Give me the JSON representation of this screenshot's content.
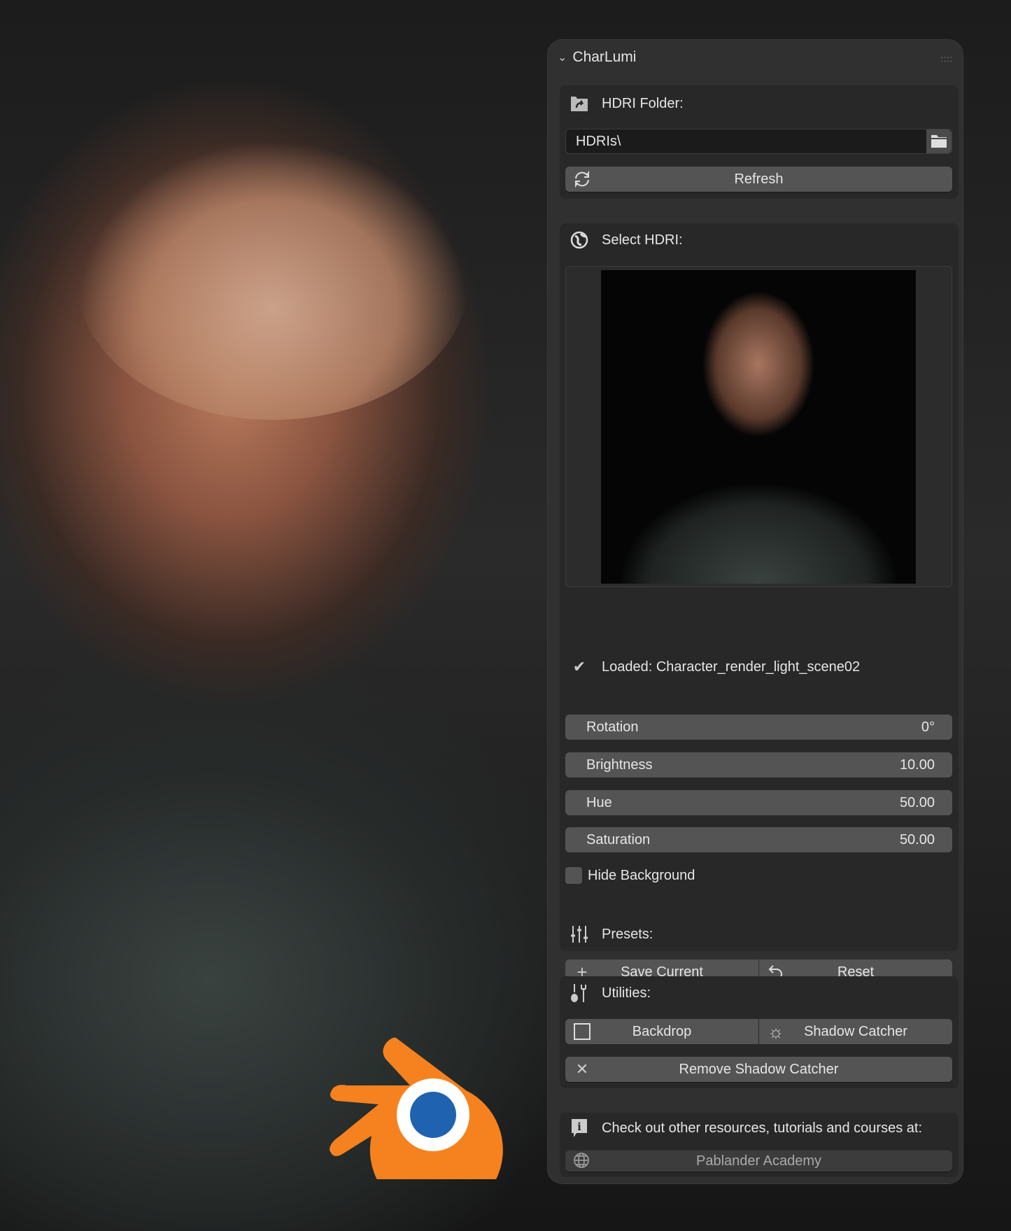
{
  "panel": {
    "title": "CharLumi"
  },
  "hdri_folder": {
    "label": "HDRI Folder:",
    "path": "HDRIs\\",
    "refresh": "Refresh"
  },
  "select_hdri": {
    "label": "Select HDRI:",
    "loaded": "Loaded: Character_render_light_scene02"
  },
  "sliders": [
    {
      "label": "Rotation",
      "value": "0°"
    },
    {
      "label": "Brightness",
      "value": "10.00"
    },
    {
      "label": "Hue",
      "value": "50.00"
    },
    {
      "label": "Saturation",
      "value": "50.00"
    }
  ],
  "hide_background": {
    "label": "Hide Background",
    "checked": false
  },
  "presets": {
    "label": "Presets:",
    "save": "Save Current",
    "reset": "Reset"
  },
  "utilities": {
    "label": "Utilities:",
    "backdrop": "Backdrop",
    "shadow_catcher": "Shadow Catcher",
    "remove_shadow_catcher": "Remove Shadow Catcher"
  },
  "info": {
    "text": "Check out other resources, tutorials and courses at:",
    "link": "Pablander Academy"
  },
  "colors": {
    "blender_orange": "#f5821f",
    "blender_blue": "#1f63b0"
  }
}
